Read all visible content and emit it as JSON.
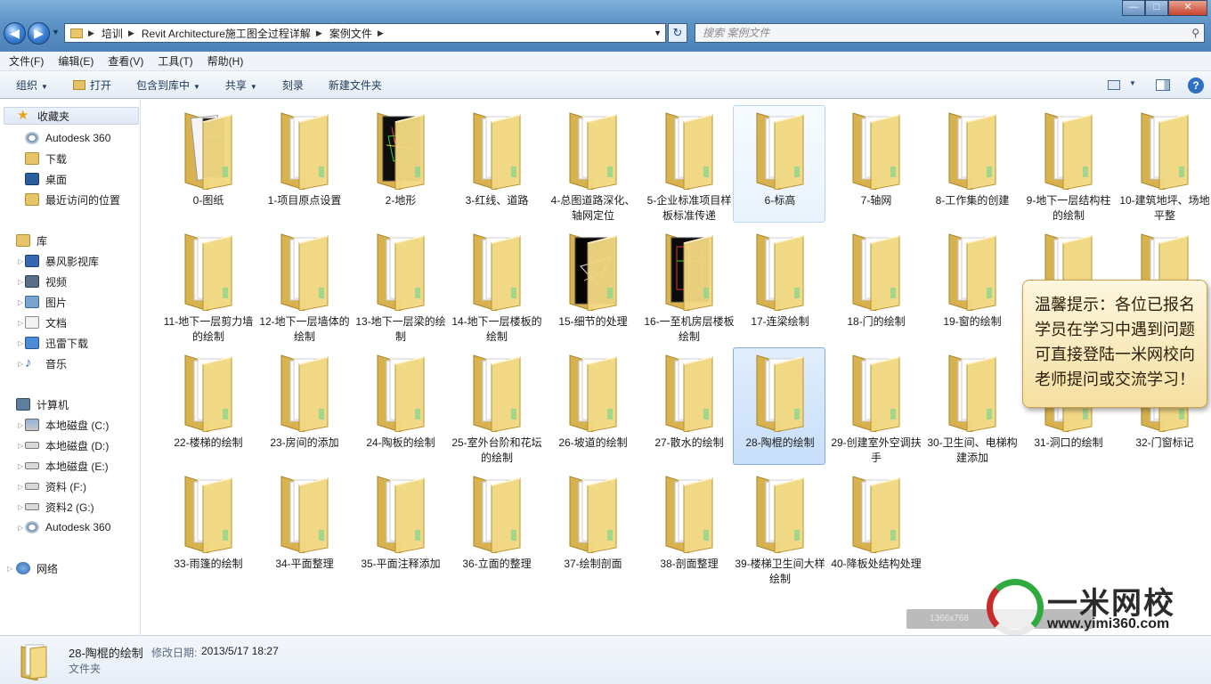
{
  "window": {
    "breadcrumbs": [
      "培训",
      "Revit Architecture施工图全过程详解",
      "案例文件"
    ],
    "search_placeholder": "搜索 案例文件"
  },
  "menu": [
    "文件(F)",
    "编辑(E)",
    "查看(V)",
    "工具(T)",
    "帮助(H)"
  ],
  "toolbar": {
    "organize": "组织",
    "open": "打开",
    "include_library": "包含到库中",
    "share": "共享",
    "burn": "刻录",
    "new_folder": "新建文件夹"
  },
  "sidebar": {
    "favorites_label": "收藏夹",
    "favorites": [
      "Autodesk 360",
      "下载",
      "桌面",
      "最近访问的位置"
    ],
    "libraries_label": "库",
    "libraries": [
      "暴风影视库",
      "视频",
      "图片",
      "文档",
      "迅雷下载",
      "音乐"
    ],
    "computer_label": "计算机",
    "drives": [
      "本地磁盘 (C:)",
      "本地磁盘 (D:)",
      "本地磁盘 (E:)",
      "资料 (F:)",
      "资料2 (G:)",
      "Autodesk 360"
    ],
    "network_label": "网络"
  },
  "folders": [
    {
      "name": "0-图纸",
      "thumb": "paper",
      "state": ""
    },
    {
      "name": "1-项目原点设置",
      "thumb": "",
      "state": ""
    },
    {
      "name": "2-地形",
      "thumb": "cad-dark",
      "state": ""
    },
    {
      "name": "3-红线、道路",
      "thumb": "",
      "state": ""
    },
    {
      "name": "4-总图道路深化、轴网定位",
      "thumb": "",
      "state": ""
    },
    {
      "name": "5-企业标准项目样板标准传递",
      "thumb": "",
      "state": ""
    },
    {
      "name": "6-标高",
      "thumb": "",
      "state": "hover"
    },
    {
      "name": "7-轴网",
      "thumb": "",
      "state": ""
    },
    {
      "name": "8-工作集的创建",
      "thumb": "",
      "state": ""
    },
    {
      "name": "9-地下一层结构柱的绘制",
      "thumb": "",
      "state": ""
    },
    {
      "name": "10-建筑地坪、场地平整",
      "thumb": "",
      "state": ""
    },
    {
      "name": "11-地下一层剪力墙的绘制",
      "thumb": "",
      "state": ""
    },
    {
      "name": "12-地下一层墙体的绘制",
      "thumb": "",
      "state": ""
    },
    {
      "name": "13-地下一层梁的绘制",
      "thumb": "",
      "state": ""
    },
    {
      "name": "14-地下一层楼板的绘制",
      "thumb": "",
      "state": ""
    },
    {
      "name": "15-细节的处理",
      "thumb": "detail-dark",
      "state": ""
    },
    {
      "name": "16-一至机房层楼板绘制",
      "thumb": "cad-red",
      "state": ""
    },
    {
      "name": "17-连梁绘制",
      "thumb": "",
      "state": ""
    },
    {
      "name": "18-门的绘制",
      "thumb": "",
      "state": ""
    },
    {
      "name": "19-窗的绘制",
      "thumb": "",
      "state": ""
    },
    {
      "name": "",
      "thumb": "",
      "state": ""
    },
    {
      "name": "",
      "thumb": "",
      "state": ""
    },
    {
      "name": "22-楼梯的绘制",
      "thumb": "",
      "state": ""
    },
    {
      "name": "23-房间的添加",
      "thumb": "",
      "state": ""
    },
    {
      "name": "24-陶板的绘制",
      "thumb": "",
      "state": ""
    },
    {
      "name": "25-室外台阶和花坛的绘制",
      "thumb": "",
      "state": ""
    },
    {
      "name": "26-坡道的绘制",
      "thumb": "",
      "state": ""
    },
    {
      "name": "27-散水的绘制",
      "thumb": "",
      "state": ""
    },
    {
      "name": "28-陶棍的绘制",
      "thumb": "",
      "state": "selected"
    },
    {
      "name": "29-创建室外空调扶手",
      "thumb": "",
      "state": ""
    },
    {
      "name": "30-卫生间、电梯构建添加",
      "thumb": "",
      "state": ""
    },
    {
      "name": "31-洞口的绘制",
      "thumb": "",
      "state": ""
    },
    {
      "name": "32-门窗标记",
      "thumb": "",
      "state": ""
    },
    {
      "name": "33-雨篷的绘制",
      "thumb": "",
      "state": ""
    },
    {
      "name": "34-平面整理",
      "thumb": "",
      "state": ""
    },
    {
      "name": "35-平面注释添加",
      "thumb": "",
      "state": ""
    },
    {
      "name": "36-立面的整理",
      "thumb": "",
      "state": ""
    },
    {
      "name": "37-绘制剖面",
      "thumb": "",
      "state": ""
    },
    {
      "name": "38-剖面整理",
      "thumb": "",
      "state": ""
    },
    {
      "name": "39-楼梯卫生间大样绘制",
      "thumb": "",
      "state": ""
    },
    {
      "name": "40-降板处结构处理",
      "thumb": "",
      "state": ""
    }
  ],
  "tip": {
    "text": "温馨提示：各位已报名学员在学习中遇到问题可直接登陆一米网校向老师提问或交流学习！"
  },
  "watermark": {
    "bar_text": "1366x768",
    "brand": "一米网校",
    "url": "www.yimi360.com"
  },
  "details": {
    "name": "28-陶棍的绘制",
    "modified_label": "修改日期:",
    "modified": "2013/5/17 18:27",
    "type": "文件夹"
  }
}
